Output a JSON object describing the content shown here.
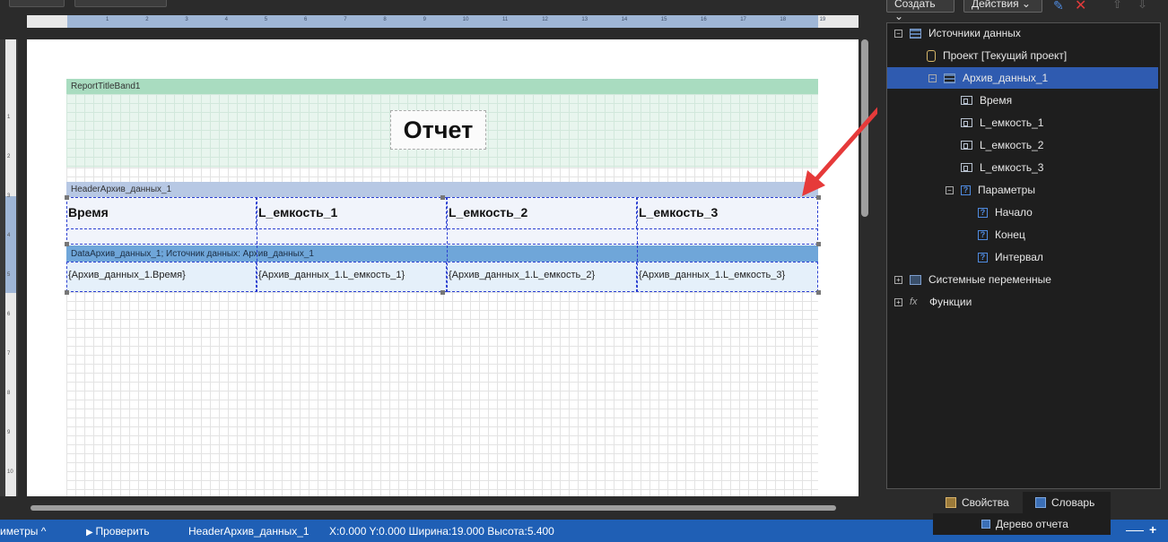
{
  "toolbar_right": {
    "create_label": "Создать",
    "actions_label": "Действия"
  },
  "ruler": {
    "h_ticks": [
      "1",
      "2",
      "3",
      "4",
      "5",
      "6",
      "7",
      "8",
      "9",
      "10",
      "11",
      "12",
      "13",
      "14",
      "15",
      "16",
      "17",
      "18",
      "19"
    ],
    "v_ticks": [
      "1",
      "2",
      "3",
      "4",
      "5",
      "6",
      "7",
      "8",
      "9",
      "10"
    ]
  },
  "report": {
    "title_band_label": "ReportTitleBand1",
    "title_text": "Отчет",
    "header_band_label": "HeaderАрхив_данных_1",
    "header_cells": [
      "Время",
      "L_емкость_1",
      "L_емкость_2",
      "L_емкость_3"
    ],
    "data_band_label": "DataАрхив_данных_1; Источник данных: Архив_данных_1",
    "data_cells": [
      "{Архив_данных_1.Время}",
      "{Архив_данных_1.L_емкость_1}",
      "{Архив_данных_1.L_емкость_2}",
      "{Архив_данных_1.L_емкость_3}"
    ]
  },
  "dictionary": {
    "nodes": [
      {
        "label": "Источники данных",
        "level": 0,
        "expander": "−",
        "icon": "table-icon"
      },
      {
        "label": "Проект [Текущий проект]",
        "level": 1,
        "expander": "",
        "icon": "database-icon"
      },
      {
        "label": "Архив_данных_1",
        "level": 2,
        "expander": "−",
        "icon": "table-icon",
        "selected": true
      },
      {
        "label": "Время",
        "level": 3,
        "expander": "",
        "icon": "field-icon"
      },
      {
        "label": "L_емкость_1",
        "level": 3,
        "expander": "",
        "icon": "field-icon"
      },
      {
        "label": "L_емкость_2",
        "level": 3,
        "expander": "",
        "icon": "field-icon"
      },
      {
        "label": "L_емкость_3",
        "level": 3,
        "expander": "",
        "icon": "field-icon"
      },
      {
        "label": "Параметры",
        "level": 3,
        "expander": "−",
        "icon": "parameter-icon"
      },
      {
        "label": "Начало",
        "level": 4,
        "expander": "",
        "icon": "parameter-icon"
      },
      {
        "label": "Конец",
        "level": 4,
        "expander": "",
        "icon": "parameter-icon"
      },
      {
        "label": "Интервал",
        "level": 4,
        "expander": "",
        "icon": "parameter-icon"
      },
      {
        "label": "Системные переменные",
        "level": 0,
        "expander": "+",
        "icon": "system-variables-icon"
      },
      {
        "label": "Функции",
        "level": 0,
        "expander": "+",
        "icon": "fx-icon"
      }
    ]
  },
  "panel_tabs": {
    "properties": "Свойства",
    "dictionary": "Словарь",
    "report_tree": "Дерево отчета"
  },
  "statusbar": {
    "params": "имeтры ^",
    "check": "Проверить",
    "component": "HeaderАрхив_данных_1",
    "coords": "X:0.000  Y:0.000  Ширина:19.000  Высота:5.400"
  }
}
